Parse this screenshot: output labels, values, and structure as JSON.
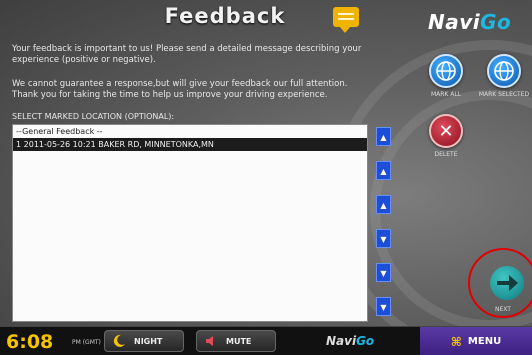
{
  "header": {
    "title": "Feedback",
    "brand_left": "Navi",
    "brand_right": "Go"
  },
  "intro": {
    "paragraph1": "Your feedback is important to us! Please send a detailed message describing your experience (positive or negative).",
    "paragraph2": "We cannot guarantee a response,but will give your feedback our full attention. Thank you for taking the time to help us improve your driving experience."
  },
  "locations": {
    "label": "SELECT MARKED LOCATION (OPTIONAL):",
    "items": [
      {
        "text": "--General Feedback --",
        "selected": false
      },
      {
        "text": "1 2011-05-26 10:21 BAKER RD, MINNETONKA,MN",
        "selected": true
      }
    ]
  },
  "scroll_buttons": [
    "scroll-top",
    "page-up",
    "up",
    "down",
    "page-down",
    "scroll-bottom"
  ],
  "actions": {
    "mark_all": "MARK ALL",
    "mark_selected": "MARK SELECTED",
    "delete": "DELETE",
    "next": "NEXT"
  },
  "bottom_bar": {
    "time": "6:08",
    "ampm": "PM (GMT)",
    "night": "NIGHT",
    "mute": "MUTE",
    "brand_left": "Navi",
    "brand_right": "Go",
    "menu": "MENU"
  },
  "colors": {
    "accent_blue": "#1db7e4",
    "clock": "#f5c400",
    "menu": "#4a2a94",
    "highlight": "#e00000"
  },
  "icons": [
    "comment-icon",
    "globe-icon",
    "delete-icon",
    "next-arrow-icon",
    "moon-icon",
    "speaker-icon",
    "menu-icon"
  ]
}
